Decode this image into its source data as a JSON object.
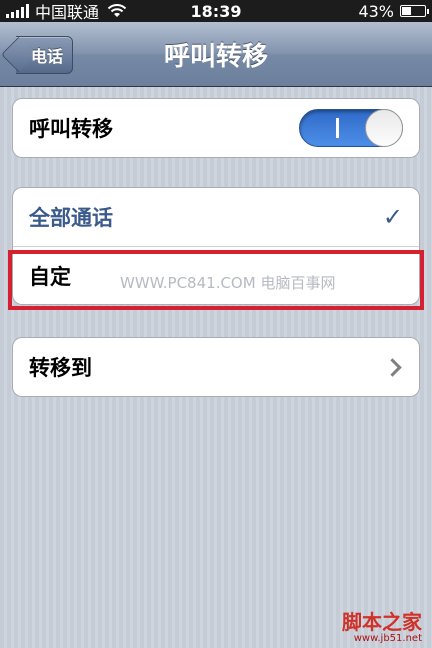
{
  "status_bar": {
    "carrier": "中国联通",
    "time": "18:39",
    "battery": "43%",
    "battery_level": 0.43
  },
  "nav": {
    "back_label": "电话",
    "title": "呼叫转移"
  },
  "settings": {
    "forwarding_label": "呼叫转移",
    "forwarding_enabled": true,
    "options": [
      {
        "label": "全部通话",
        "selected": true
      },
      {
        "label": "自定",
        "selected": false
      }
    ],
    "forward_to_label": "转移到"
  },
  "watermark": "WWW.PC841.COM 电脑百事网",
  "footer": {
    "brand": "脚本之家",
    "url": "www.jb51.net"
  },
  "colors": {
    "accent": "#3a5a8c",
    "highlight": "#d42030",
    "toggle_on": "#2f6bc9"
  }
}
